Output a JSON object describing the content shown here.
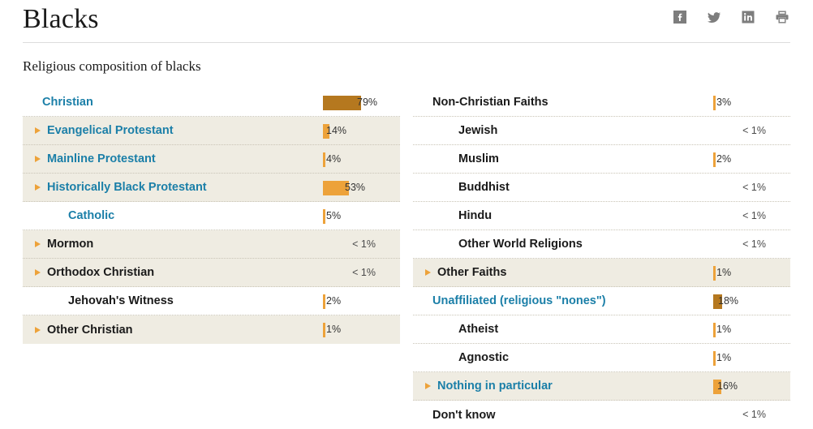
{
  "header": {
    "title": "Blacks",
    "social": [
      {
        "name": "facebook-icon",
        "label": "Facebook"
      },
      {
        "name": "twitter-icon",
        "label": "Twitter"
      },
      {
        "name": "linkedin-icon",
        "label": "LinkedIn"
      },
      {
        "name": "print-icon",
        "label": "Print"
      }
    ]
  },
  "subtitle": "Religious composition of blacks",
  "colors": {
    "parent_bar": "#b5781f",
    "child_bar": "#eda23a",
    "link_text": "#1b7fa8",
    "shaded_row": "#efece2",
    "arrow": "#eda23a"
  },
  "chart_data": {
    "type": "bar",
    "title": "Religious composition of blacks",
    "xlabel": "",
    "ylabel": "",
    "xlim": [
      0,
      100
    ],
    "grid": false,
    "legend": null,
    "note": "Horizontal percentage bars; values shown as data labels. '< 1%' rows have no bar.",
    "categories": [
      "Christian",
      "Evangelical Protestant",
      "Mainline Protestant",
      "Historically Black Protestant",
      "Catholic",
      "Mormon",
      "Orthodox Christian",
      "Jehovah's Witness",
      "Other Christian",
      "Non-Christian Faiths",
      "Jewish",
      "Muslim",
      "Buddhist",
      "Hindu",
      "Other World Religions",
      "Other Faiths",
      "Unaffiliated (religious \"nones\")",
      "Atheist",
      "Agnostic",
      "Nothing in particular",
      "Don't know"
    ],
    "values": [
      79,
      14,
      4,
      53,
      5,
      0.5,
      0.5,
      2,
      1,
      3,
      0.5,
      2,
      0.5,
      0.5,
      0.5,
      1,
      18,
      1,
      1,
      16,
      0.5
    ],
    "value_labels": [
      "79%",
      "14%",
      "4%",
      "53%",
      "5%",
      "< 1%",
      "< 1%",
      "2%",
      "1%",
      "3%",
      "< 1%",
      "2%",
      "< 1%",
      "< 1%",
      "< 1%",
      "1%",
      "18%",
      "1%",
      "1%",
      "16%",
      "< 1%"
    ]
  },
  "left_column": [
    {
      "label": "Christian",
      "value": "79%",
      "pct": 79,
      "bar": "parent",
      "arrow": false,
      "link": true,
      "indent": 0,
      "shaded": false
    },
    {
      "label": "Evangelical Protestant",
      "value": "14%",
      "pct": 14,
      "bar": "child",
      "arrow": true,
      "link": true,
      "indent": 1,
      "shaded": true
    },
    {
      "label": "Mainline Protestant",
      "value": "4%",
      "pct": 4,
      "bar": "child",
      "arrow": true,
      "link": true,
      "indent": 1,
      "shaded": true
    },
    {
      "label": "Historically Black Protestant",
      "value": "53%",
      "pct": 53,
      "bar": "child",
      "arrow": true,
      "link": true,
      "indent": 1,
      "shaded": true
    },
    {
      "label": "Catholic",
      "value": "5%",
      "pct": 5,
      "bar": "child",
      "arrow": false,
      "link": true,
      "indent": 2,
      "shaded": false
    },
    {
      "label": "Mormon",
      "value": "< 1%",
      "pct": 0,
      "bar": "none",
      "arrow": true,
      "link": false,
      "indent": 1,
      "shaded": true
    },
    {
      "label": "Orthodox Christian",
      "value": "< 1%",
      "pct": 0,
      "bar": "none",
      "arrow": true,
      "link": false,
      "indent": 1,
      "shaded": true
    },
    {
      "label": "Jehovah's Witness",
      "value": "2%",
      "pct": 2,
      "bar": "child",
      "arrow": false,
      "link": false,
      "indent": 2,
      "shaded": false
    },
    {
      "label": "Other Christian",
      "value": "1%",
      "pct": 1,
      "bar": "child",
      "arrow": true,
      "link": false,
      "indent": 1,
      "shaded": true
    }
  ],
  "right_column": [
    {
      "label": "Non-Christian Faiths",
      "value": "3%",
      "pct": 3,
      "bar": "child",
      "arrow": false,
      "link": false,
      "indent": 0,
      "shaded": false
    },
    {
      "label": "Jewish",
      "value": "< 1%",
      "pct": 0,
      "bar": "none",
      "arrow": false,
      "link": false,
      "indent": 2,
      "shaded": false
    },
    {
      "label": "Muslim",
      "value": "2%",
      "pct": 2,
      "bar": "child",
      "arrow": false,
      "link": false,
      "indent": 2,
      "shaded": false
    },
    {
      "label": "Buddhist",
      "value": "< 1%",
      "pct": 0,
      "bar": "none",
      "arrow": false,
      "link": false,
      "indent": 2,
      "shaded": false
    },
    {
      "label": "Hindu",
      "value": "< 1%",
      "pct": 0,
      "bar": "none",
      "arrow": false,
      "link": false,
      "indent": 2,
      "shaded": false
    },
    {
      "label": "Other World Religions",
      "value": "< 1%",
      "pct": 0,
      "bar": "none",
      "arrow": false,
      "link": false,
      "indent": 2,
      "shaded": false
    },
    {
      "label": "Other Faiths",
      "value": "1%",
      "pct": 1,
      "bar": "child",
      "arrow": true,
      "link": false,
      "indent": 1,
      "shaded": true
    },
    {
      "label": "Unaffiliated (religious \"nones\")",
      "value": "18%",
      "pct": 18,
      "bar": "parent",
      "arrow": false,
      "link": true,
      "indent": 0,
      "shaded": false
    },
    {
      "label": "Atheist",
      "value": "1%",
      "pct": 1,
      "bar": "child",
      "arrow": false,
      "link": false,
      "indent": 2,
      "shaded": false
    },
    {
      "label": "Agnostic",
      "value": "1%",
      "pct": 1,
      "bar": "child",
      "arrow": false,
      "link": false,
      "indent": 2,
      "shaded": false
    },
    {
      "label": "Nothing in particular",
      "value": "16%",
      "pct": 16,
      "bar": "child",
      "arrow": true,
      "link": true,
      "indent": 1,
      "shaded": true
    },
    {
      "label": "Don't know",
      "value": "< 1%",
      "pct": 0,
      "bar": "none",
      "arrow": false,
      "link": false,
      "indent": 0,
      "shaded": false
    }
  ]
}
